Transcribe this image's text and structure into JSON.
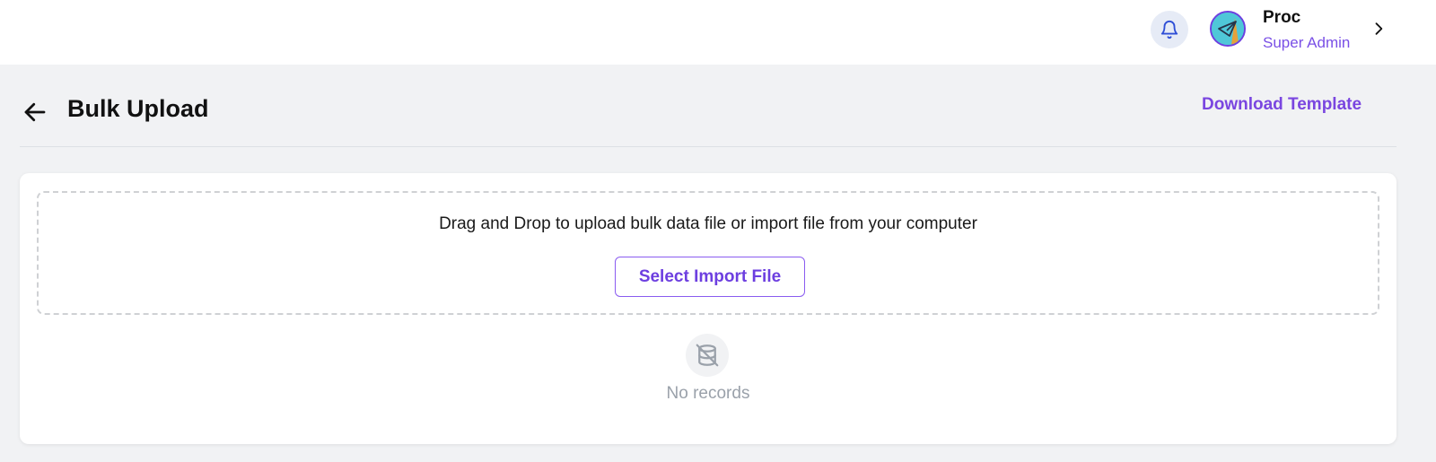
{
  "header": {
    "notification_icon": "bell-icon",
    "user": {
      "name": "Proc",
      "role": "Super Admin",
      "avatar_icon": "paper-plane-avatar",
      "menu_icon": "chevron-right-icon"
    }
  },
  "page": {
    "back_icon": "arrow-left-icon",
    "title": "Bulk Upload",
    "download_template_label": "Download Template"
  },
  "upload": {
    "instructions": "Drag and Drop to upload bulk data file or import file from your computer",
    "select_button_label": "Select Import File"
  },
  "records": {
    "empty_icon": "database-off-icon",
    "empty_text": "No records"
  },
  "colors": {
    "accent": "#7a46e0",
    "page_background": "#f1f2f4",
    "muted_text": "#9aa1aa",
    "bell_background": "#e6ebf6",
    "bell_icon": "#2f4fd6"
  }
}
